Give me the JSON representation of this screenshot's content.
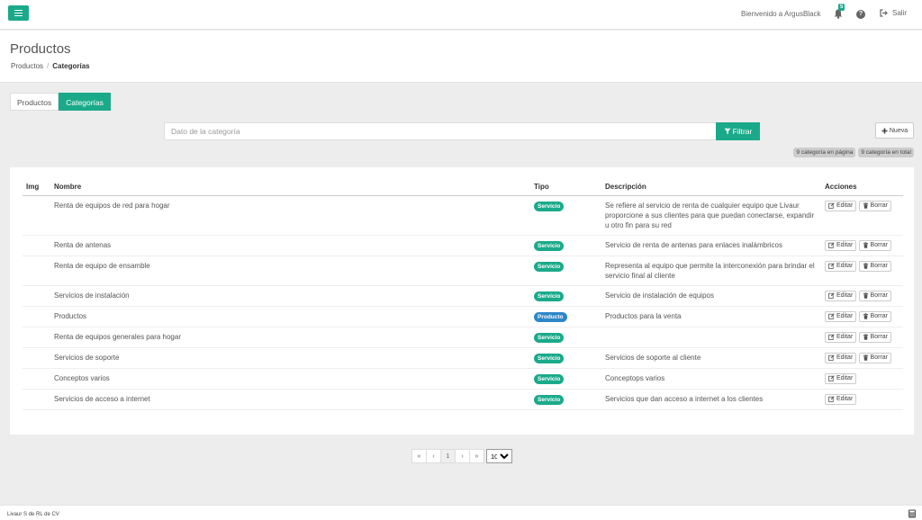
{
  "topbar": {
    "welcome": "Bienvenido a ArgusBlack",
    "notifications": "5",
    "logout": "Salir"
  },
  "header": {
    "title": "Productos",
    "breadcrumb": [
      "Productos",
      "Categorías"
    ]
  },
  "tabs": [
    {
      "label": "Productos",
      "active": false
    },
    {
      "label": "Categorías",
      "active": true
    }
  ],
  "search": {
    "placeholder": "Dato de la categoría",
    "filter_label": "Filtrar",
    "new_label": "Nueva"
  },
  "counts": {
    "page": "9 categoría en página",
    "total": "9 categoría en total"
  },
  "table": {
    "headers": [
      "Img",
      "Nombre",
      "Tipo",
      "Descripción",
      "Acciones"
    ],
    "edit_label": "Editar",
    "delete_label": "Borrar",
    "rows": [
      {
        "name": "Renta de equipos de red para hogar",
        "type": "Servicio",
        "desc": "Se refiere al servicio de renta de cualquier equipo que Livaur proporcione a sus clientes para que puedan conectarse, expandir u otro fin para su red",
        "can_delete": true
      },
      {
        "name": "Renta de antenas",
        "type": "Servicio",
        "desc": "Servicio de renta de antenas para enlaces inalámbricos",
        "can_delete": true
      },
      {
        "name": "Renta de equipo de ensamble",
        "type": "Servicio",
        "desc": "Representa al equipo que permite la interconexión para brindar el servicio final al cliente",
        "can_delete": true
      },
      {
        "name": "Servicios de instalación",
        "type": "Servicio",
        "desc": "Servicio de instalación de equipos",
        "can_delete": true
      },
      {
        "name": "Productos",
        "type": "Producto",
        "desc": "Productos para la venta",
        "can_delete": true
      },
      {
        "name": "Renta de equipos generales para hogar",
        "type": "Servicio",
        "desc": "",
        "can_delete": true
      },
      {
        "name": "Servicios de soporte",
        "type": "Servicio",
        "desc": "Servicios de soporte al cliente",
        "can_delete": true
      },
      {
        "name": "Conceptos varios",
        "type": "Servicio",
        "desc": "Conceptops varios",
        "can_delete": false
      },
      {
        "name": "Servicios de acceso a internet",
        "type": "Servicio",
        "desc": "Servicios que dan acceso a internet a los clientes",
        "can_delete": false
      }
    ]
  },
  "pagination": {
    "first": "«",
    "prev": "‹",
    "current": "1",
    "next": "›",
    "last": "»",
    "page_size": "10"
  },
  "footer": {
    "text": "Livaur S de RL de CV"
  },
  "colors": {
    "accent": "#1aaa8a",
    "product": "#2e86c8"
  },
  "icons": {
    "menu": "menu-icon",
    "bell": "bell-icon",
    "help": "question-circle-icon",
    "logout": "sign-out-icon",
    "filter": "filter-icon",
    "new": "plus-icon",
    "edit": "edit-icon",
    "delete": "trash-icon",
    "footer": "calculator-icon"
  }
}
